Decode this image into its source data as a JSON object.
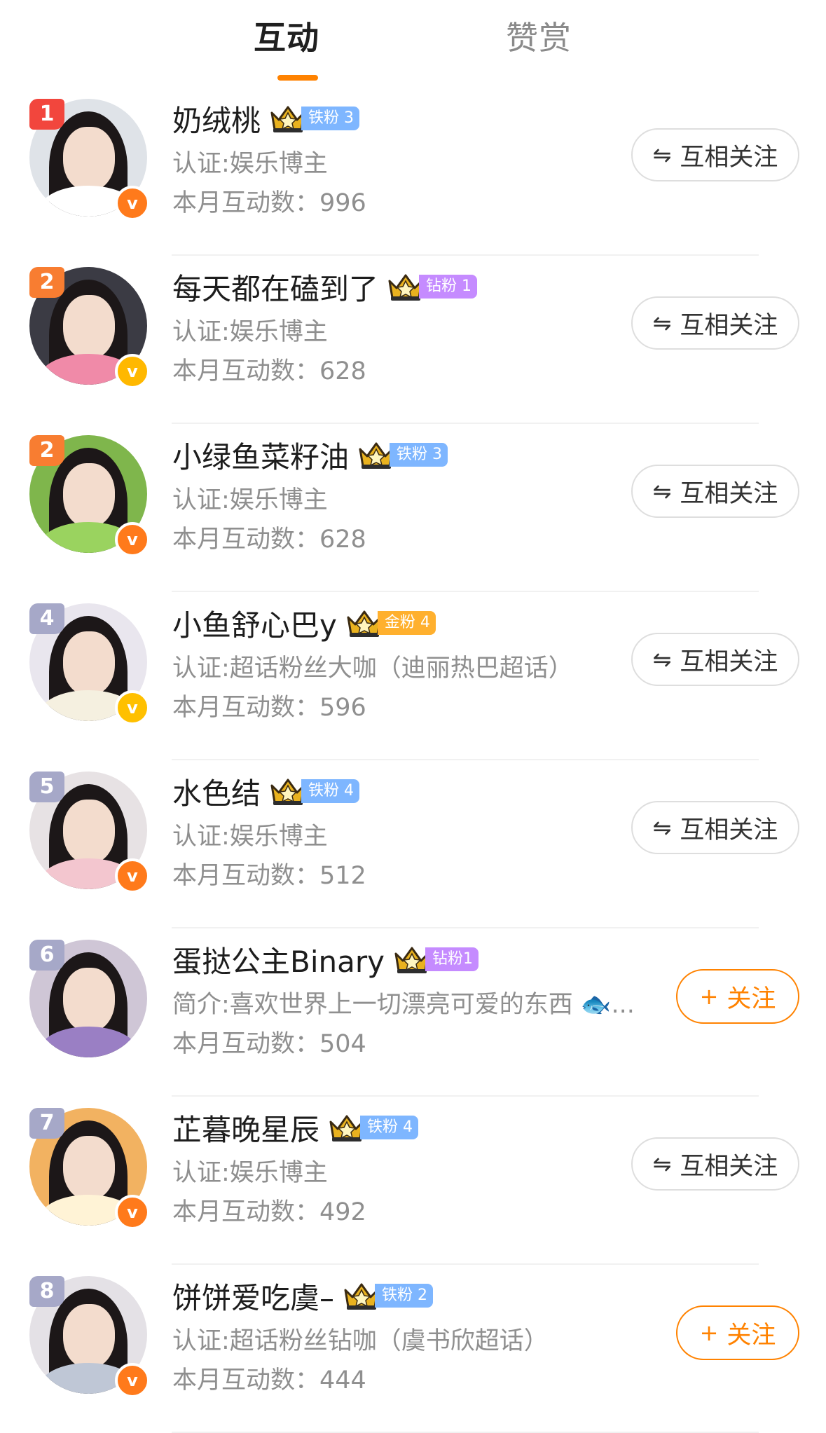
{
  "tabs": {
    "active": "互动",
    "other": "赞赏"
  },
  "colors": {
    "accent": "#ff8200",
    "mutual_border": "#dedede",
    "gray_text": "#8f8f8f"
  },
  "users": [
    {
      "rank": "1",
      "rank_color": "#f2463d",
      "name": "奶绒桃",
      "fan_tag": "铁粉 3",
      "fan_color": "#7eb6ff",
      "crown_level": "1",
      "desc": "认证:娱乐博主",
      "count": "本月互动数：996",
      "button": "互相关注",
      "button_type": "mutual",
      "verify_color": "#ff7a1b",
      "avatar_bg": "#dfe3e8",
      "avatar_body": "#ffffff"
    },
    {
      "rank": "2",
      "rank_color": "#f87d31",
      "name": "每天都在磕到了",
      "fan_tag": "钻粉 1",
      "fan_color": "#c58bff",
      "crown_level": "II",
      "desc": "认证:娱乐博主",
      "count": "本月互动数：628",
      "button": "互相关注",
      "button_type": "mutual",
      "verify_color": "#ffb800",
      "avatar_bg": "#3b3b44",
      "avatar_body": "#f08aa8"
    },
    {
      "rank": "2",
      "rank_color": "#f87d31",
      "name": "小绿鱼菜籽油",
      "fan_tag": "铁粉 3",
      "fan_color": "#7eb6ff",
      "crown_level": "1",
      "desc": "认证:娱乐博主",
      "count": "本月互动数：628",
      "button": "互相关注",
      "button_type": "mutual",
      "verify_color": "#ff7a1b",
      "avatar_bg": "#7fb64c",
      "avatar_body": "#9ad35f"
    },
    {
      "rank": "4",
      "rank_color": "#a6a8c8",
      "name": "小鱼舒心巴y",
      "fan_tag": "金粉 4",
      "fan_color": "#ffb02e",
      "crown_level": "6",
      "desc": "认证:超话粉丝大咖（迪丽热巴超话）",
      "count": "本月互动数：596",
      "button": "互相关注",
      "button_type": "mutual",
      "verify_color": "#ffc000",
      "avatar_bg": "#e9e6ee",
      "avatar_body": "#f5f0e0"
    },
    {
      "rank": "5",
      "rank_color": "#a6a8c8",
      "name": "水色结",
      "fan_tag": "铁粉 4",
      "fan_color": "#7eb6ff",
      "crown_level": "1",
      "desc": "认证:娱乐博主",
      "count": "本月互动数：512",
      "button": "互相关注",
      "button_type": "mutual",
      "verify_color": "#ff7a1b",
      "avatar_bg": "#e7e2e4",
      "avatar_body": "#f3c6cf"
    },
    {
      "rank": "6",
      "rank_color": "#a6a8c8",
      "name": "蛋挞公主Binary",
      "fan_tag": "钻粉1",
      "fan_color": "#c58bff",
      "crown_level": "4",
      "desc": "简介:喜欢世界上一切漂亮可爱的东西 🐟...",
      "count": "本月互动数：504",
      "button": "关注",
      "button_type": "follow",
      "verify_color": "",
      "avatar_bg": "#cfc6d6",
      "avatar_body": "#9a7fc4"
    },
    {
      "rank": "7",
      "rank_color": "#a6a8c8",
      "name": "芷暮晚星辰",
      "fan_tag": "铁粉 4",
      "fan_color": "#7eb6ff",
      "crown_level": "1",
      "desc": "认证:娱乐博主",
      "count": "本月互动数：492",
      "button": "互相关注",
      "button_type": "mutual",
      "verify_color": "#ff7a1b",
      "avatar_bg": "#f2b261",
      "avatar_body": "#fff3d6"
    },
    {
      "rank": "8",
      "rank_color": "#a6a8c8",
      "name": "饼饼爱吃虞–",
      "fan_tag": "铁粉 2",
      "fan_color": "#7eb6ff",
      "crown_level": "1",
      "desc": "认证:超话粉丝钻咖（虞书欣超话）",
      "count": "本月互动数：444",
      "button": "关注",
      "button_type": "follow",
      "verify_color": "#ff7a1b",
      "avatar_bg": "#e4e1e6",
      "avatar_body": "#bfc7d6"
    }
  ]
}
